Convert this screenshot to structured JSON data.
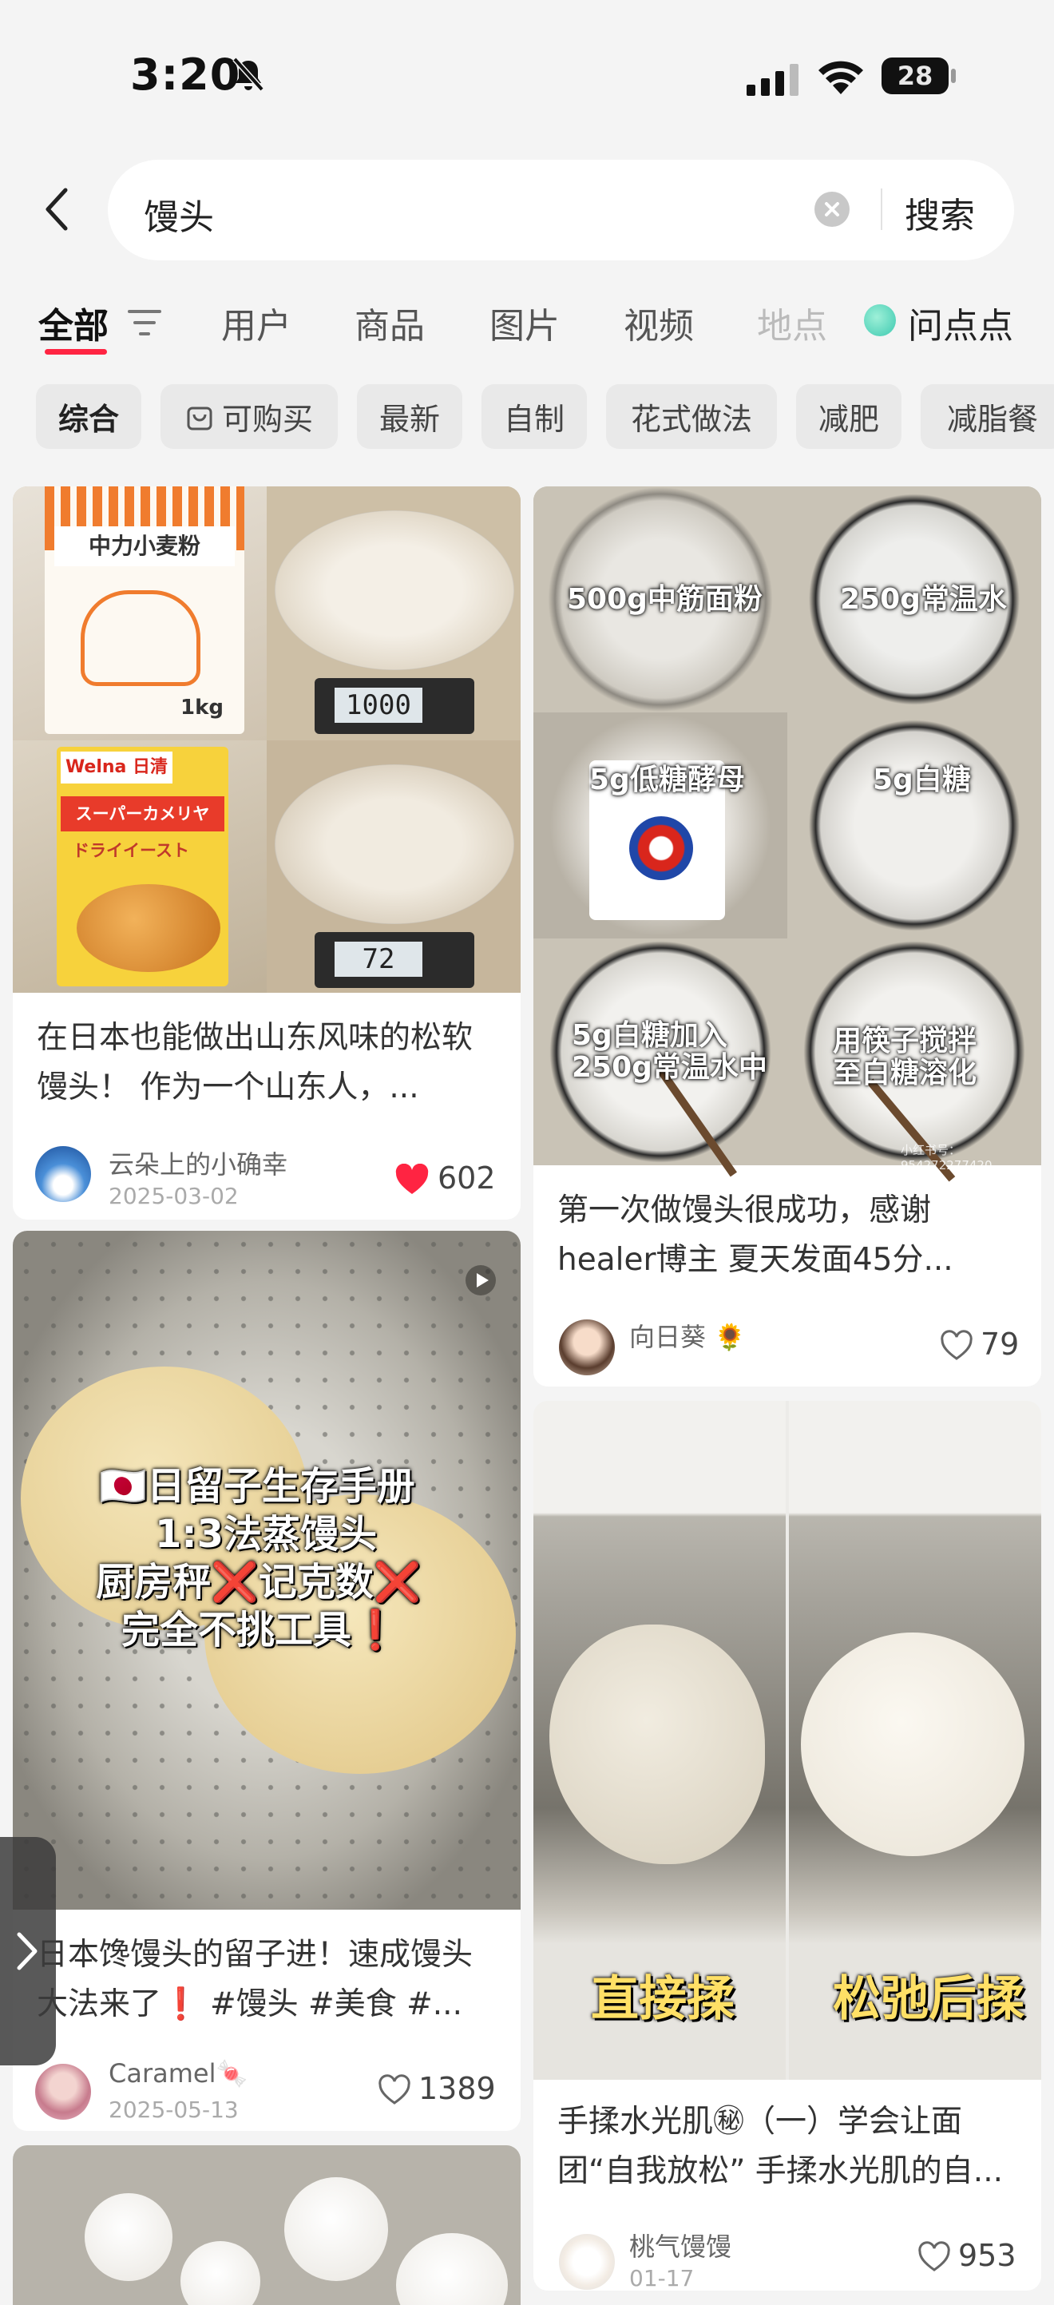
{
  "status_bar": {
    "time": "3:20",
    "battery": "28",
    "icons": [
      "mute-icon",
      "signal-icon",
      "wifi-icon",
      "battery-icon"
    ]
  },
  "search": {
    "query": "馒头",
    "button_label": "搜索"
  },
  "tabs": [
    {
      "label": "全部",
      "active": true
    },
    {
      "label": "用户"
    },
    {
      "label": "商品"
    },
    {
      "label": "图片"
    },
    {
      "label": "视频"
    },
    {
      "label": "地点"
    },
    {
      "label": "问点点"
    }
  ],
  "chips": [
    "综合",
    "可购买",
    "最新",
    "自制",
    "花式做法",
    "减肥",
    "减脂餐"
  ],
  "cards": [
    {
      "title": "在日本也能做出山东风味的松软馒头！ 作为一个山东人，...",
      "author": "云朵上的小确幸",
      "date": "2025-03-02",
      "likes": "602",
      "liked": true,
      "image_text": {
        "bag": "中力小麦粉",
        "bag_weight": "1kg",
        "scale1": "1000",
        "scale2": "72",
        "brand": "Welna 日清",
        "yeast": "スーパーカメリヤ",
        "yeast_sub": "ドライイースト"
      }
    },
    {
      "title": "第一次做馒头很成功，感谢healer博主 夏天发面45分...",
      "author": "向日葵",
      "author_emoji": "🌻",
      "likes": "79",
      "liked": false,
      "image_captions": [
        "500g中筋面粉",
        "250g常温水",
        "5g低糖酵母",
        "5g白糖",
        "5g白糖加入\n250g常温水中",
        "用筷子搅拌\n至白糖溶化"
      ],
      "watermark": "小红书号：954272277420"
    },
    {
      "title": "日本馋馒头的留子进！速成馒头大法来了❗ #馒头 #美食 #...",
      "author": "Caramel",
      "author_emoji": "🍬",
      "date": "2025-05-13",
      "likes": "1389",
      "liked": false,
      "image_lines": [
        "🇯🇵日留子生存手册",
        "1:3法蒸馒头",
        "厨房秤❌记克数❌",
        "完全不挑工具❗"
      ]
    },
    {
      "title": "手揉水光肌㊙（一）学会让面团“自我放松” 手揉水光肌的自...",
      "author": "桃气馒馒",
      "date": "01-17",
      "likes": "953",
      "liked": false,
      "image_captions": [
        "直接揉",
        "松弛后揉"
      ]
    }
  ],
  "colors": {
    "accent": "#ff2442",
    "background": "#f4f4f4",
    "card": "#ffffff"
  }
}
